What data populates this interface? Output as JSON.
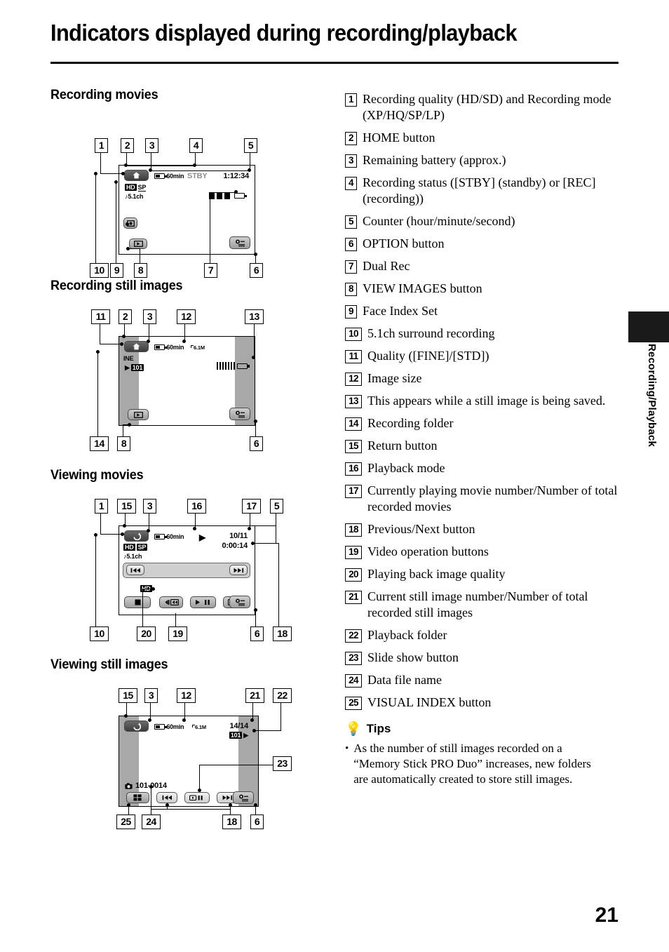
{
  "page": {
    "title": "Indicators displayed during recording/playback",
    "number": "21",
    "side_tab": "Recording/Playback"
  },
  "sections": [
    {
      "heading": "Recording movies"
    },
    {
      "heading": "Recording still images"
    },
    {
      "heading": "Viewing movies"
    },
    {
      "heading": "Viewing still images"
    }
  ],
  "diagram_recording_movies": {
    "callouts_top": [
      "1",
      "2",
      "3",
      "4",
      "5"
    ],
    "callouts_bottom": [
      "10",
      "9",
      "8",
      "7",
      "6"
    ],
    "osd": {
      "battery": "60min",
      "status": "STBY",
      "counter": "1:12:34",
      "quality_hd": "HD",
      "quality_mode": "SP",
      "audio": "5.1ch"
    }
  },
  "diagram_recording_still": {
    "callouts_top": [
      "11",
      "2",
      "3",
      "12",
      "13"
    ],
    "callouts_bottom": [
      "14",
      "8",
      "6"
    ],
    "osd": {
      "battery": "60min",
      "image_size": "6.1M",
      "quality": "INE",
      "folder": "101"
    }
  },
  "diagram_viewing_movies": {
    "callouts_top": [
      "1",
      "15",
      "3",
      "16",
      "17",
      "5"
    ],
    "callouts_bottom": [
      "10",
      "20",
      "19",
      "6",
      "18"
    ],
    "osd": {
      "battery": "60min",
      "movie_number": "10/11",
      "counter": "0:00:14",
      "quality_hd": "HD",
      "quality_mode": "SP",
      "audio": "5.1ch",
      "playback_quality": "HD"
    }
  },
  "diagram_viewing_still": {
    "callouts_top": [
      "15",
      "3",
      "12",
      "21",
      "22"
    ],
    "callouts_right": [
      "23"
    ],
    "callouts_bottom": [
      "25",
      "24",
      "18",
      "6"
    ],
    "osd": {
      "battery": "60min",
      "image_size": "6.1M",
      "still_number": "14/14",
      "folder": "101",
      "file_name": "101-0014"
    }
  },
  "legend": [
    {
      "num": "1",
      "text": "Recording quality (HD/SD) and Recording mode (XP/HQ/SP/LP)"
    },
    {
      "num": "2",
      "text": "HOME button"
    },
    {
      "num": "3",
      "text": "Remaining battery (approx.)"
    },
    {
      "num": "4",
      "text": "Recording status ([STBY] (standby) or [REC] (recording))"
    },
    {
      "num": "5",
      "text": "Counter (hour/minute/second)"
    },
    {
      "num": "6",
      "text": "OPTION button"
    },
    {
      "num": "7",
      "text": "Dual Rec"
    },
    {
      "num": "8",
      "text": "VIEW IMAGES button"
    },
    {
      "num": "9",
      "text": "Face Index Set"
    },
    {
      "num": "10",
      "text": "5.1ch surround recording"
    },
    {
      "num": "11",
      "text": "Quality ([FINE]/[STD])"
    },
    {
      "num": "12",
      "text": "Image size"
    },
    {
      "num": "13",
      "text": "This appears while a still image is being saved."
    },
    {
      "num": "14",
      "text": "Recording folder"
    },
    {
      "num": "15",
      "text": "Return button"
    },
    {
      "num": "16",
      "text": "Playback mode"
    },
    {
      "num": "17",
      "text": "Currently playing movie number/Number of total recorded movies"
    },
    {
      "num": "18",
      "text": "Previous/Next button"
    },
    {
      "num": "19",
      "text": "Video operation buttons"
    },
    {
      "num": "20",
      "text": "Playing back image quality"
    },
    {
      "num": "21",
      "text": "Current still image number/Number of total recorded still images"
    },
    {
      "num": "22",
      "text": "Playback folder"
    },
    {
      "num": "23",
      "text": "Slide show button"
    },
    {
      "num": "24",
      "text": "Data file name"
    },
    {
      "num": "25",
      "text": "VISUAL INDEX button"
    }
  ],
  "tips": {
    "label": "Tips",
    "items": [
      "As the number of still images recorded on a “Memory Stick PRO Duo” increases, new folders are automatically created to store still images."
    ]
  }
}
